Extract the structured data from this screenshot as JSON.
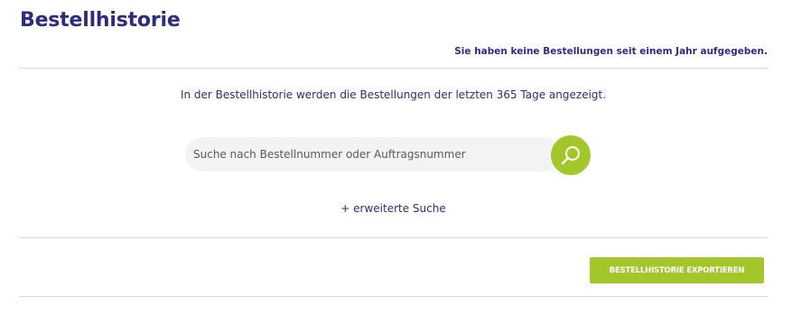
{
  "page": {
    "title": "Bestellhistorie",
    "notice": "Sie haben keine Bestellungen seit einem Jahr aufgegeben.",
    "info_text": "In der Bestellhistorie werden die Bestellungen der letzten 365 Tage angezeigt."
  },
  "search": {
    "placeholder": "Suche nach Bestellnummer oder Auftragsnummer",
    "value": "",
    "button_icon": "search-icon"
  },
  "advanced_search": {
    "label": "+ erweiterte Suche"
  },
  "export": {
    "label": "BESTELLHISTORIE EXPORTIEREN"
  },
  "colors": {
    "primary_text": "#2f2c80",
    "accent_green": "#a3c72a",
    "input_background": "#f2f3f4",
    "divider": "#d8d8d8"
  }
}
